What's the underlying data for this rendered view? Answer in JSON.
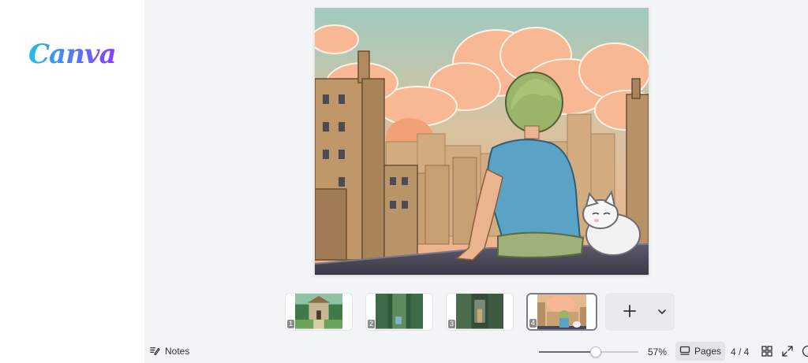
{
  "app": {
    "logo_text": "Canva"
  },
  "thumbnails": [
    {
      "number": "1",
      "scene": "forest-building"
    },
    {
      "number": "2",
      "scene": "green-alley"
    },
    {
      "number": "3",
      "scene": "overgrown-alley"
    },
    {
      "number": "4",
      "scene": "rooftop-city",
      "active": true
    }
  ],
  "footer": {
    "notes_label": "Notes",
    "zoom_value": "57%",
    "zoom_fraction": 0.57,
    "pages_label": "Pages",
    "page_counter": "4 / 4"
  },
  "colors": {
    "sky_top": "#9cc9bf",
    "cloud": "#f7b58f",
    "building": "#b9956c",
    "shirt": "#5aa3c7",
    "hair": "#8aa860"
  },
  "icons": {
    "notes": "notes-icon",
    "add": "plus-icon",
    "expand": "chevron-down-icon",
    "pages": "pages-icon",
    "grid": "grid-view-icon",
    "fullscreen": "fullscreen-icon",
    "help": "help-icon"
  }
}
